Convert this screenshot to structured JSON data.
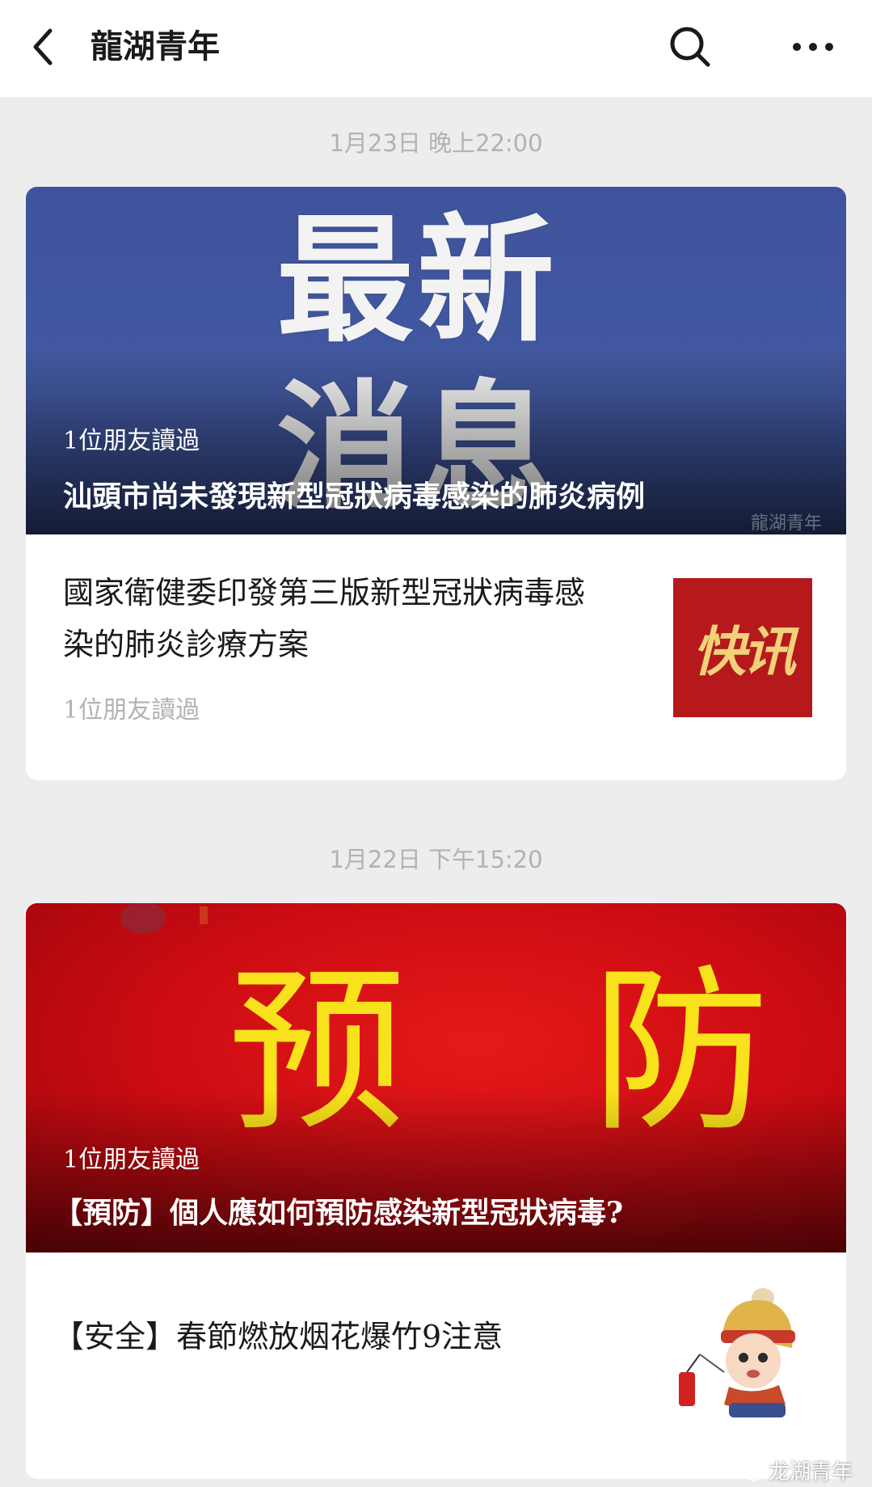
{
  "header": {
    "title": "龍湖青年",
    "back_icon": "chevron-left-icon",
    "search_icon": "search-icon",
    "more_icon": "more-dots-icon"
  },
  "groups": [
    {
      "timestamp": "1月23日 晚上22:00",
      "hero": {
        "big_text_line1": "最新",
        "big_text_line2": "消息",
        "readers": "1位朋友讀過",
        "headline": "汕頭市尚未發現新型冠狀病毒感染的肺炎病例",
        "watermark": "龍湖青年"
      },
      "item": {
        "title": "國家衛健委印發第三版新型冠狀病毒感染的肺炎診療方案",
        "readers": "1位朋友讀過",
        "thumb_text": "快讯"
      }
    },
    {
      "timestamp": "1月22日 下午15:20",
      "hero": {
        "big_text_line1": "预  防",
        "readers": "1位朋友讀過",
        "headline": "【預防】個人應如何預防感染新型冠狀病毒?"
      },
      "item": {
        "title": "【安全】春節燃放烟花爆竹9注意",
        "thumb_icon": "cartoon-child-firecracker-icon"
      }
    }
  ],
  "footer_watermark": "龙湖青年",
  "colors": {
    "page_bg": "#ededed",
    "blue_hero": "#4258a0",
    "red_hero": "#cc0c12",
    "yellow_text": "#f8e21b",
    "muted_text": "#b2b2b2"
  }
}
